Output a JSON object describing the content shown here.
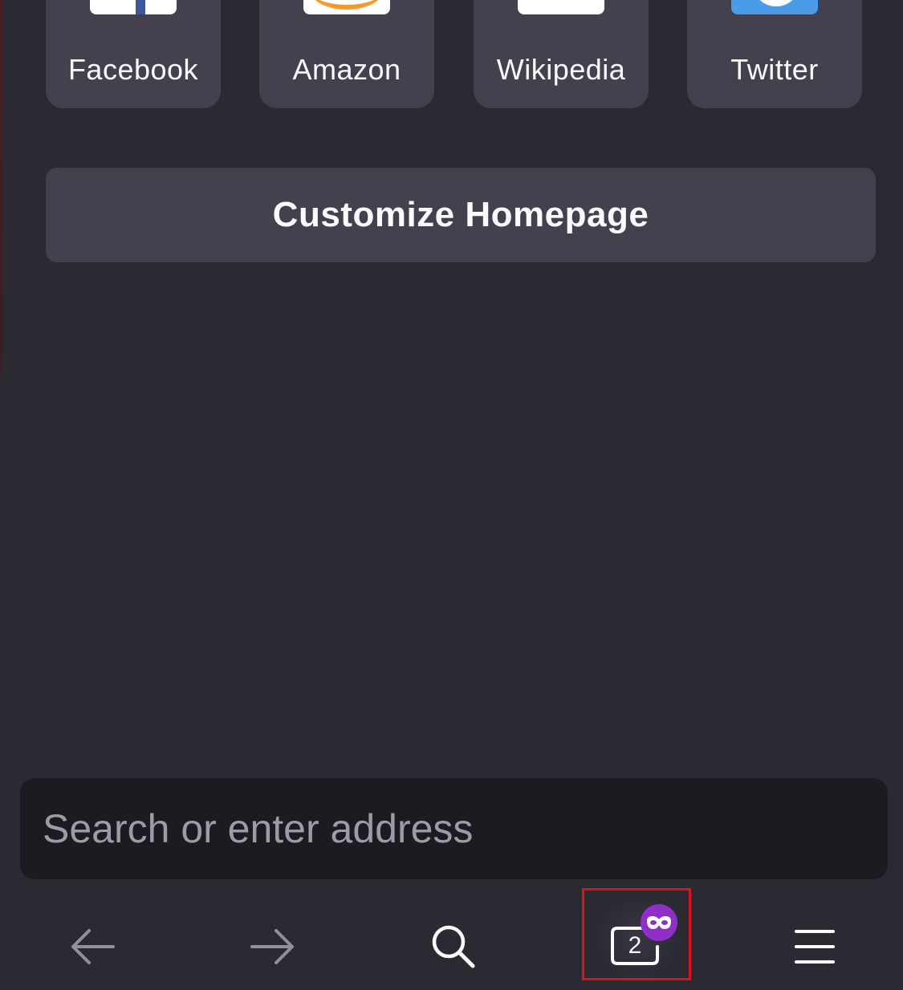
{
  "top_sites": [
    {
      "label": "Facebook",
      "icon": "facebook-icon"
    },
    {
      "label": "Amazon",
      "icon": "amazon-icon"
    },
    {
      "label": "Wikipedia",
      "icon": "wikipedia-icon"
    },
    {
      "label": "Twitter",
      "icon": "twitter-icon"
    }
  ],
  "customize": {
    "label": "Customize Homepage"
  },
  "address_bar": {
    "placeholder": "Search or enter address"
  },
  "toolbar": {
    "back_icon": "back-arrow-icon",
    "forward_icon": "forward-arrow-icon",
    "search_icon": "search-icon",
    "tabs": {
      "count": "2",
      "icon": "tabs-icon",
      "badge_icon": "private-mask-icon"
    },
    "menu_icon": "hamburger-menu-icon"
  },
  "colors": {
    "background": "#2b2a33",
    "tile": "#42414d",
    "address_bg": "#1c1b22",
    "private_badge": "#8f2fc7",
    "highlight": "#e0121b"
  }
}
